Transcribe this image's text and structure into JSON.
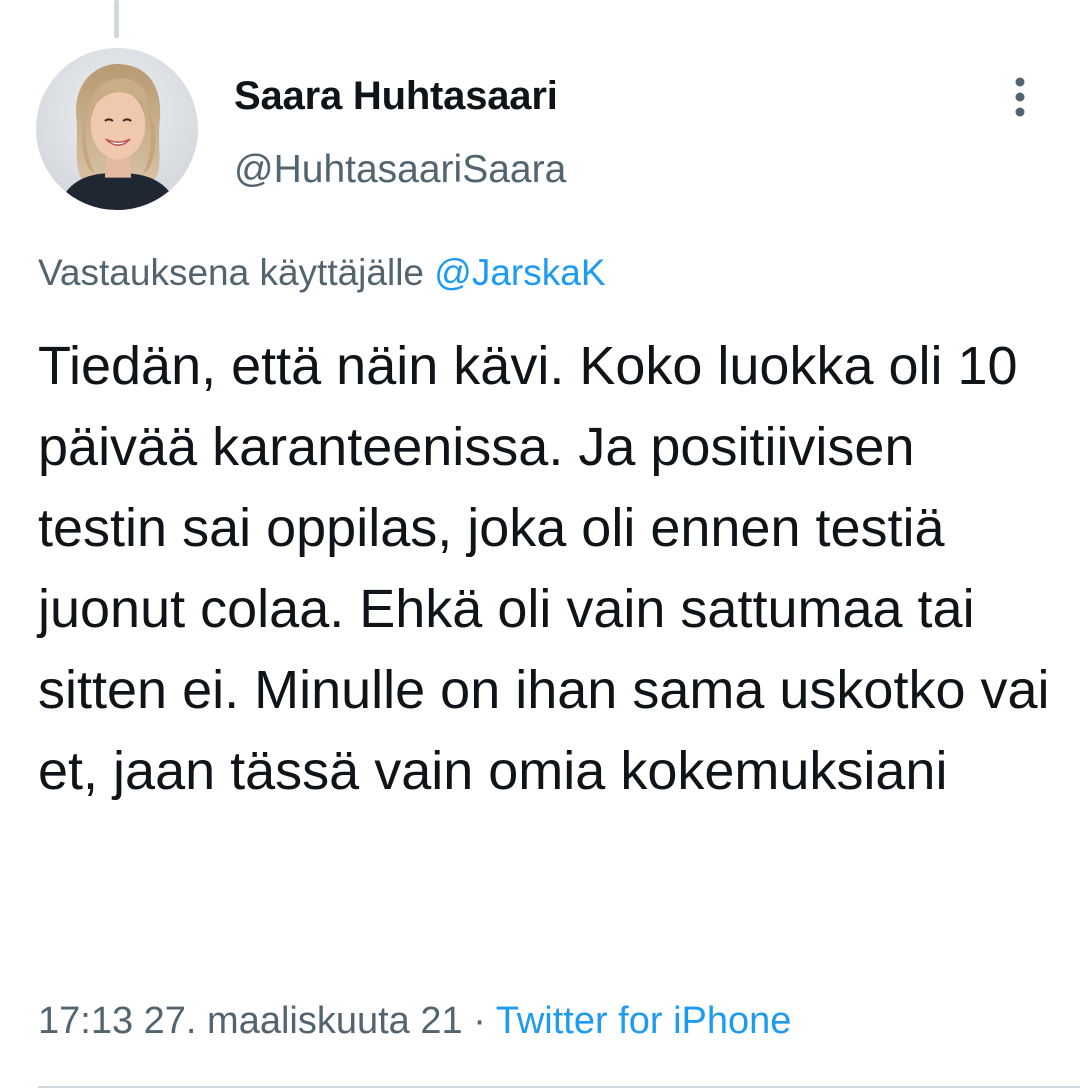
{
  "author": {
    "display_name": "Saara Huhtasaari",
    "handle": "@HuhtasaariSaara"
  },
  "reply_context": {
    "prefix": "Vastauksena käyttäjälle",
    "mention": "@JarskaK"
  },
  "tweet": {
    "text": "Tiedän, että näin kävi. Koko luokka oli 10 päivää karanteenissa. Ja positiivisen testin sai oppilas, joka oli ennen testiä juonut colaa. Ehkä oli vain sattumaa tai sitten ei. Minulle on ihan sama uskotko vai et, jaan tässä vain omia kokemuksiani"
  },
  "meta": {
    "timestamp": "17:13 27. maaliskuuta 21",
    "separator": "·",
    "source": "Twitter for iPhone"
  },
  "icons": {
    "more": "more-vertical-icon"
  },
  "colors": {
    "text": "#0f1419",
    "secondary": "#536471",
    "link": "#1d9bf0",
    "divider": "#cfd9de"
  }
}
